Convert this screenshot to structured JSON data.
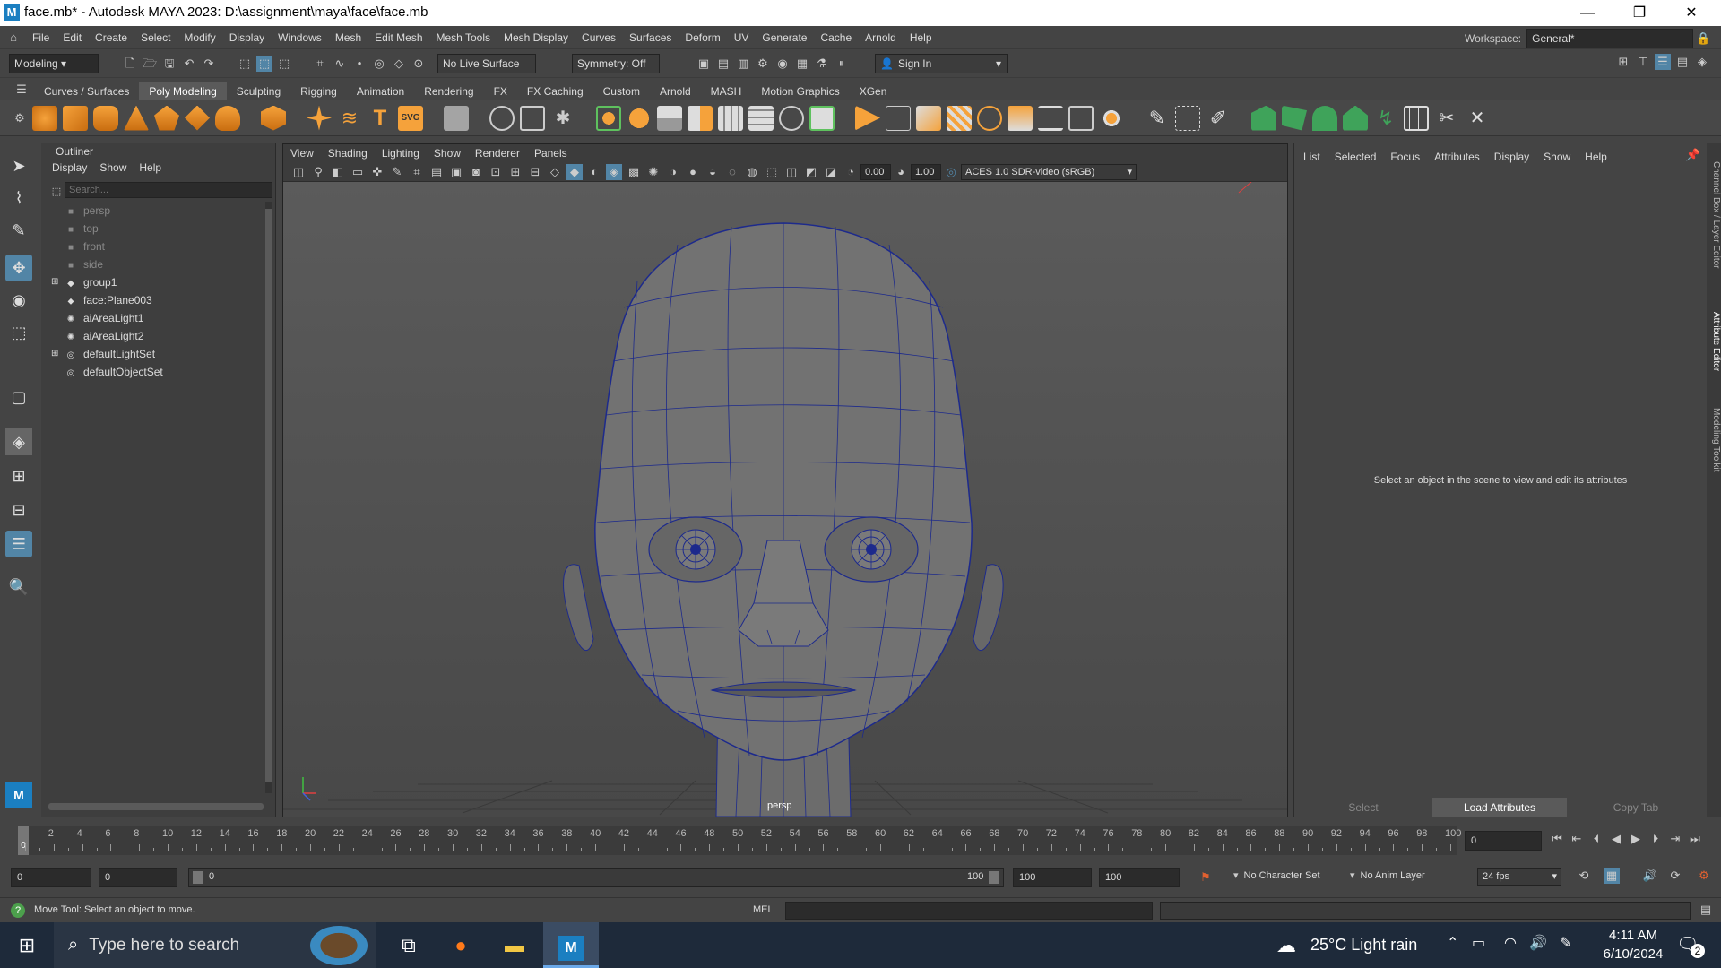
{
  "window": {
    "app_icon": "M",
    "title": "face.mb* - Autodesk MAYA 2023: D:\\assignment\\maya\\face\\face.mb",
    "minimize": "—",
    "maximize": "❐",
    "close": "✕"
  },
  "menubar": [
    "File",
    "Edit",
    "Create",
    "Select",
    "Modify",
    "Display",
    "Windows",
    "Mesh",
    "Edit Mesh",
    "Mesh Tools",
    "Mesh Display",
    "Curves",
    "Surfaces",
    "Deform",
    "UV",
    "Generate",
    "Cache",
    "Arnold",
    "Help"
  ],
  "workspace": {
    "label": "Workspace:",
    "value": "General*"
  },
  "toolbar": {
    "mode": "Modeling",
    "live_surface": "No Live Surface",
    "symmetry": "Symmetry: Off",
    "sign_in": "Sign In"
  },
  "shelf_tabs": [
    "Curves / Surfaces",
    "Poly Modeling",
    "Sculpting",
    "Rigging",
    "Animation",
    "Rendering",
    "FX",
    "FX Caching",
    "Custom",
    "Arnold",
    "MASH",
    "Motion Graphics",
    "XGen"
  ],
  "shelf_active": "Poly Modeling",
  "outliner": {
    "title": "Outliner",
    "menu": [
      "Display",
      "Show",
      "Help"
    ],
    "search_placeholder": "Search...",
    "items": [
      {
        "label": "persp",
        "icon": "camera-icon",
        "dim": true
      },
      {
        "label": "top",
        "icon": "camera-icon",
        "dim": true
      },
      {
        "label": "front",
        "icon": "camera-icon",
        "dim": true
      },
      {
        "label": "side",
        "icon": "camera-icon",
        "dim": true
      },
      {
        "label": "group1",
        "icon": "group-icon",
        "dim": false,
        "expand": "+"
      },
      {
        "label": "face:Plane003",
        "icon": "mesh-icon",
        "dim": false
      },
      {
        "label": "aiAreaLight1",
        "icon": "light-icon",
        "dim": false
      },
      {
        "label": "aiAreaLight2",
        "icon": "light-icon",
        "dim": false
      },
      {
        "label": "defaultLightSet",
        "icon": "set-icon",
        "dim": false,
        "expand": "+"
      },
      {
        "label": "defaultObjectSet",
        "icon": "set-icon",
        "dim": false
      }
    ]
  },
  "viewport": {
    "menu": [
      "View",
      "Shading",
      "Lighting",
      "Show",
      "Renderer",
      "Panels"
    ],
    "exposure": "0.00",
    "gamma": "1.00",
    "color_space": "ACES 1.0 SDR-video (sRGB)",
    "camera_label": "persp"
  },
  "attribute_editor": {
    "menu": [
      "List",
      "Selected",
      "Focus",
      "Attributes",
      "Display",
      "Show",
      "Help"
    ],
    "message": "Select an object in the scene to view and edit its attributes",
    "buttons": {
      "select": "Select",
      "load": "Load Attributes",
      "copy": "Copy Tab"
    }
  },
  "side_tabs": [
    "Channel Box / Layer Editor",
    "Attribute Editor",
    "Modeling Toolkit"
  ],
  "timeline": {
    "ticks": [
      "0",
      "2",
      "4",
      "6",
      "8",
      "10",
      "12",
      "14",
      "16",
      "18",
      "20",
      "22",
      "24",
      "26",
      "28",
      "30",
      "32",
      "34",
      "36",
      "38",
      "40",
      "42",
      "44",
      "46",
      "48",
      "50",
      "52",
      "54",
      "56",
      "58",
      "60",
      "62",
      "64",
      "66",
      "68",
      "70",
      "72",
      "74",
      "76",
      "78",
      "80",
      "82",
      "84",
      "86",
      "88",
      "90",
      "92",
      "94",
      "96",
      "98",
      "100"
    ],
    "current_frame": "0",
    "current_marker": "0"
  },
  "range": {
    "start": "0",
    "anim_start": "0",
    "slider_start": "0",
    "slider_end": "100",
    "anim_end": "100",
    "end": "100",
    "character_set": "No Character Set",
    "anim_layer": "No Anim Layer",
    "fps": "24 fps"
  },
  "command": {
    "help": "Move Tool: Select an object to move.",
    "lang": "MEL"
  },
  "taskbar": {
    "search": "Type here to search",
    "weather": "25°C  Light rain",
    "time": "4:11 AM",
    "date": "6/10/2024",
    "notifications": "2"
  },
  "colors": {
    "accent": "#5285a6",
    "wire": "#1d2a8c",
    "maya_blue": "#1b7fc1"
  }
}
